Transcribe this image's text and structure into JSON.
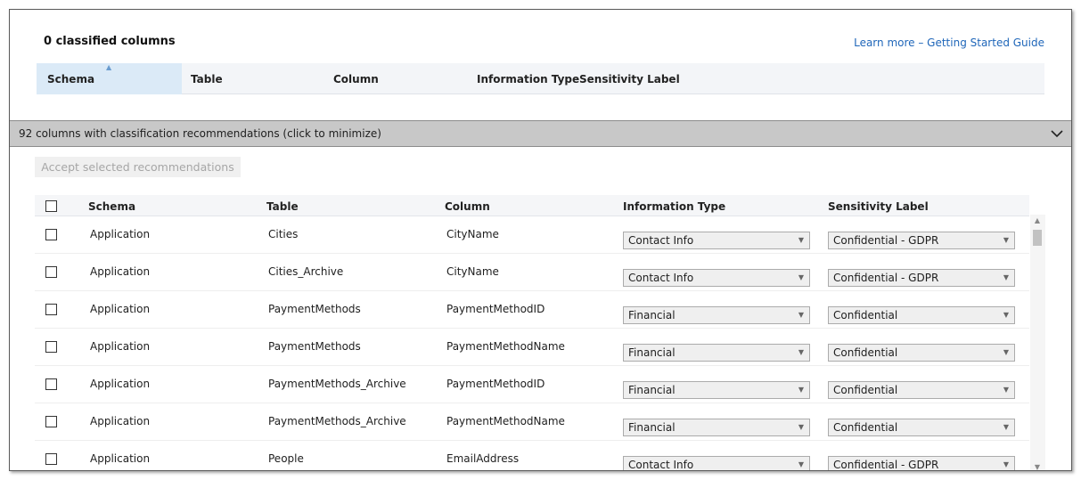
{
  "top": {
    "title": "0 classified columns",
    "learn_link": "Learn more – Getting Started Guide",
    "headers": {
      "schema": "Schema",
      "table": "Table",
      "column": "Column",
      "info_type": "Information Type",
      "sensitivity": "Sensitivity Label"
    }
  },
  "recommendations": {
    "bar_label": "92 columns with classification recommendations (click to minimize)",
    "accept_button": "Accept selected recommendations",
    "headers": {
      "schema": "Schema",
      "table": "Table",
      "column": "Column",
      "info_type": "Information Type",
      "sensitivity": "Sensitivity Label"
    },
    "rows": [
      {
        "schema": "Application",
        "table": "Cities",
        "column": "CityName",
        "info_type": "Contact Info",
        "sensitivity": "Confidential - GDPR"
      },
      {
        "schema": "Application",
        "table": "Cities_Archive",
        "column": "CityName",
        "info_type": "Contact Info",
        "sensitivity": "Confidential - GDPR"
      },
      {
        "schema": "Application",
        "table": "PaymentMethods",
        "column": "PaymentMethodID",
        "info_type": "Financial",
        "sensitivity": "Confidential"
      },
      {
        "schema": "Application",
        "table": "PaymentMethods",
        "column": "PaymentMethodName",
        "info_type": "Financial",
        "sensitivity": "Confidential"
      },
      {
        "schema": "Application",
        "table": "PaymentMethods_Archive",
        "column": "PaymentMethodID",
        "info_type": "Financial",
        "sensitivity": "Confidential"
      },
      {
        "schema": "Application",
        "table": "PaymentMethods_Archive",
        "column": "PaymentMethodName",
        "info_type": "Financial",
        "sensitivity": "Confidential"
      },
      {
        "schema": "Application",
        "table": "People",
        "column": "EmailAddress",
        "info_type": "Contact Info",
        "sensitivity": "Confidential - GDPR"
      }
    ]
  },
  "icons": {
    "chevron": "chevron-down-icon",
    "dropdown": "dropdown-arrow-icon",
    "sort": "sort-ascending-icon"
  },
  "colors": {
    "link": "#1f66b9",
    "bar": "#c8c8c8",
    "header_bg": "#f3f5f8",
    "sorted_header": "#dbeaf7"
  }
}
